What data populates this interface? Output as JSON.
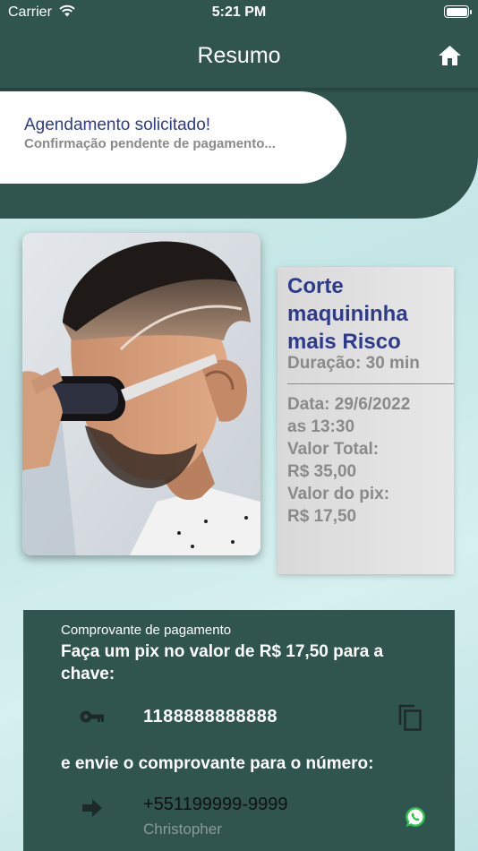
{
  "status_bar": {
    "carrier": "Carrier",
    "time": "5:21 PM"
  },
  "nav": {
    "title": "Resumo",
    "home_icon": "home-icon"
  },
  "banner": {
    "title": "Agendamento solicitado!",
    "subtitle": "Confirmação pendente de pagamento..."
  },
  "service": {
    "name": "Corte maquininha mais Risco",
    "duration": "Duração: 30 min",
    "details": [
      "Data: 29/6/2022",
      "as 13:30",
      "Valor Total:",
      "R$ 35,00",
      "Valor do pix:",
      "R$ 17,50"
    ]
  },
  "payment": {
    "label": "Comprovante de pagamento",
    "instruction": "Faça um pix no valor de R$ 17,50 para a chave:",
    "pix_key": "1188888888888",
    "send_text": "e envie o comprovante para o número:",
    "phone": "+551199999-9999",
    "contact_name": "Christopher"
  },
  "colors": {
    "primary": "#30554f",
    "accent_text": "#2e3b8c",
    "muted_text": "#8a8a8a"
  }
}
